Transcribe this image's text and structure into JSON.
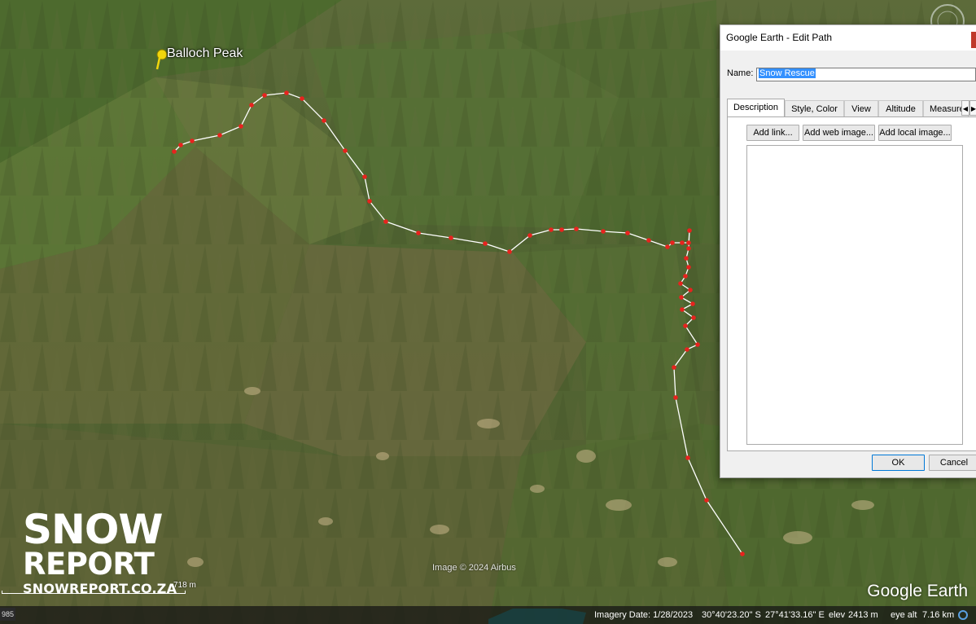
{
  "map": {
    "placemark_label": "Balloch Peak",
    "copyright": "Image © 2024 Airbus",
    "logo": "Google Earth",
    "scale_label": "718 m",
    "overview_label": "985",
    "path_color": "#ffffff",
    "vertex_color": "#e8231e",
    "pin_color": "#f2d60c"
  },
  "status": {
    "imagery_date": "Imagery Date: 1/28/2023",
    "lat": "30°40'23.20\" S",
    "lon": "27°41'33.16\" E",
    "elev_label": "elev",
    "elev_value": "2413 m",
    "eye_alt_label": "eye alt",
    "eye_alt_value": "7.16 km"
  },
  "watermark": {
    "line1": "SNOW",
    "line2": "REPORT",
    "line3": "SNOWREPORT.CO.ZA"
  },
  "dialog": {
    "title": "Google Earth - Edit Path",
    "name_label": "Name:",
    "name_value": "Snow Rescue",
    "tabs": [
      "Description",
      "Style, Color",
      "View",
      "Altitude",
      "Measure"
    ],
    "buttons": {
      "add_link": "Add link...",
      "add_web_image": "Add web image...",
      "add_local_image": "Add local image...",
      "ok": "OK",
      "cancel": "Cancel"
    },
    "description_value": ""
  }
}
